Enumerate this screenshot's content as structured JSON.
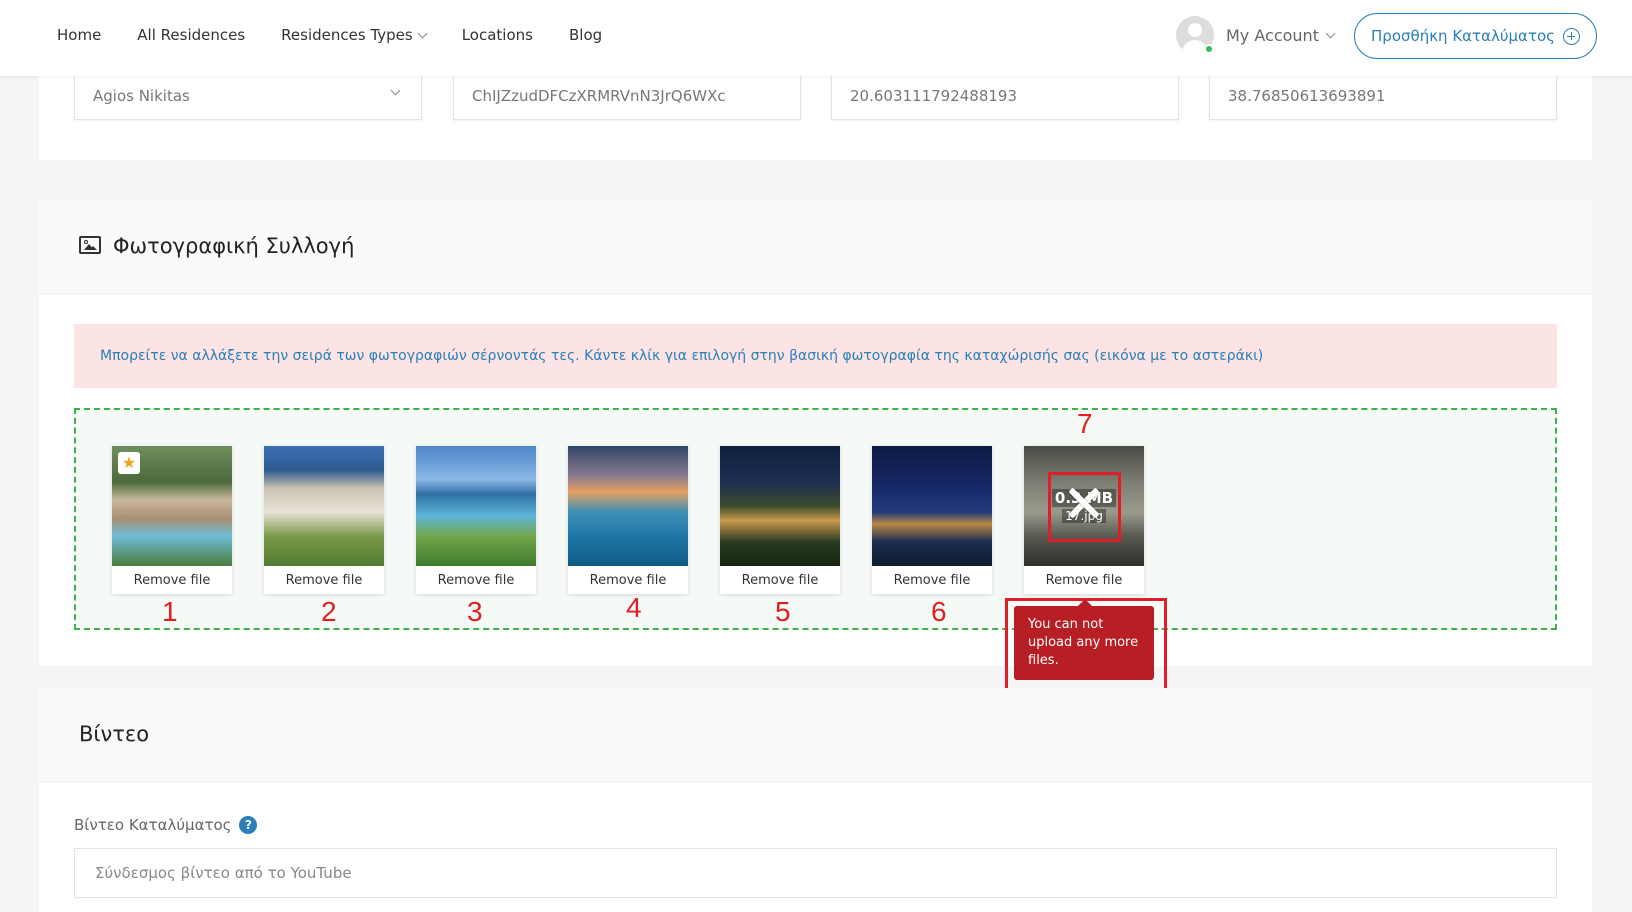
{
  "nav": {
    "items": [
      {
        "label": "Home"
      },
      {
        "label": "All Residences"
      },
      {
        "label": "Residences Types"
      },
      {
        "label": "Locations"
      },
      {
        "label": "Blog"
      }
    ]
  },
  "account": {
    "label": "My Account"
  },
  "add_listing": {
    "label": "Προσθήκη Καταλύματος"
  },
  "location_fields": {
    "area": "Agios Nikitas",
    "place_id": "ChIJZzudDFCzXRMRVnN3JrQ6WXc",
    "longitude": "20.603111792488193",
    "latitude": "38.76850613693891"
  },
  "gallery": {
    "title": "Φωτογραφική Συλλογή",
    "notice": "Μπορείτε να αλλάξετε την σειρά των φωτογραφιών σέρνοντάς τες. Κάντε κλίκ για επιλογή στην βασική φωτογραφία της καταχώρισής σας (εικόνα με το αστεράκι)",
    "remove_label": "Remove file",
    "numbers": [
      "1",
      "2",
      "3",
      "4",
      "5",
      "6",
      "7"
    ],
    "rejected_file": {
      "size": "0.3 MB",
      "name": "17.jpg"
    },
    "error": "You can not upload any more files."
  },
  "video": {
    "title": "Βίντεο",
    "label": "Βίντεο Καταλύματος",
    "help": "?",
    "placeholder": "Σύνδεσμος βίντεο από το YouTube"
  },
  "colors": {
    "accent": "#2a7fb8",
    "error": "#b81f24",
    "annotation": "#e11d2a",
    "dropzone_border": "#3bb34a"
  }
}
